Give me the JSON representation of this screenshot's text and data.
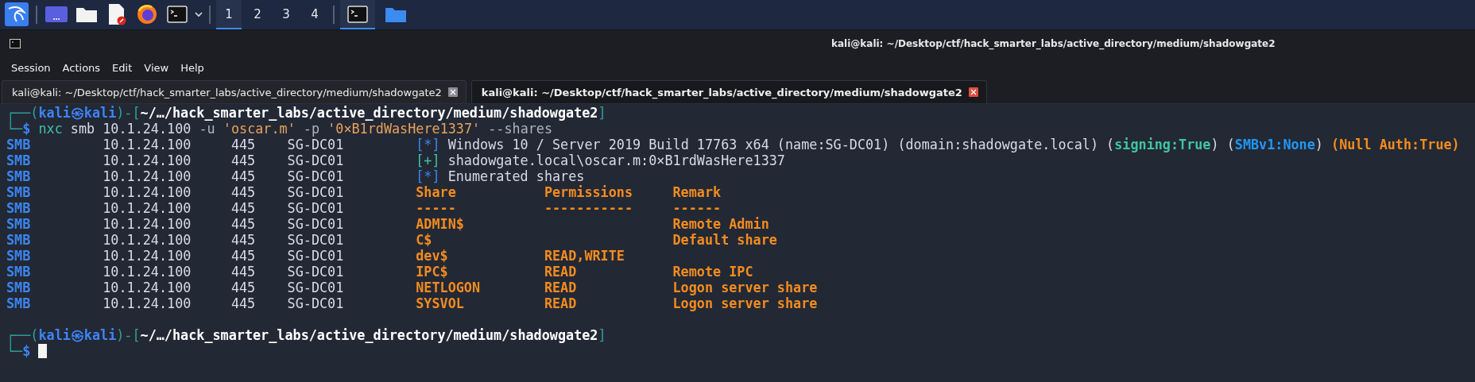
{
  "taskbar": {
    "workspaces": [
      {
        "label": "1",
        "selected": true
      },
      {
        "label": "2",
        "selected": false
      },
      {
        "label": "3",
        "selected": false
      },
      {
        "label": "4",
        "selected": false
      }
    ],
    "windows": [
      {
        "kind": "terminal",
        "active": true
      },
      {
        "kind": "folder",
        "active": false
      }
    ]
  },
  "window": {
    "title": "kali@kali: ~/Desktop/ctf/hack_smarter_labs/active_directory/medium/shadowgate2"
  },
  "menu": [
    "Session",
    "Actions",
    "Edit",
    "View",
    "Help"
  ],
  "tabs": [
    {
      "label": "kali@kali: ~/Desktop/ctf/hack_smarter_labs/active_directory/medium/shadowgate2",
      "selected": false
    },
    {
      "label": "kali@kali: ~/Desktop/ctf/hack_smarter_labs/active_directory/medium/shadowgate2",
      "selected": true
    }
  ],
  "terminal": {
    "blocks": [
      {
        "kind": "prompt",
        "frame_top": [
          {
            "text": "┌──(",
            "kind": "frame"
          },
          {
            "text": "kali㉿kali",
            "kind": "user"
          },
          {
            "text": ")-[",
            "kind": "frame"
          },
          {
            "text": "~/…/hack_smarter_labs/active_directory/medium/shadowgate2",
            "kind": "path"
          },
          {
            "text": "]",
            "kind": "frame"
          }
        ],
        "frame_bottom": "└─",
        "sign": "$",
        "command": [
          {
            "text": "nxc",
            "kind": "program"
          },
          {
            "text": " smb 10.1.24.100 ",
            "kind": "plain"
          },
          {
            "text": "-u",
            "kind": "option"
          },
          {
            "text": " 'oscar.m' ",
            "kind": "string"
          },
          {
            "text": "-p",
            "kind": "option"
          },
          {
            "text": " '0×B1rdWasHere1337' ",
            "kind": "string"
          },
          {
            "text": "--shares",
            "kind": "option"
          }
        ]
      },
      {
        "kind": "message",
        "protocol": "SMB",
        "ip": "10.1.24.100",
        "port": "445",
        "host": "SG-DC01",
        "marker": {
          "text": "[*]",
          "kind": "info"
        },
        "segments": [
          {
            "text": "Windows 10 / Server 2019 Build 17763 x64 (name:SG-DC01) (domain:shadowgate.local) (",
            "kind": "plain"
          },
          {
            "text": "signing:True",
            "kind": "good"
          },
          {
            "text": ") (",
            "kind": "plain"
          },
          {
            "text": "SMBv1:None",
            "kind": "note"
          },
          {
            "text": ") ",
            "kind": "plain"
          },
          {
            "text": "(Null Auth:True)",
            "kind": "warn"
          }
        ]
      },
      {
        "kind": "message",
        "protocol": "SMB",
        "ip": "10.1.24.100",
        "port": "445",
        "host": "SG-DC01",
        "marker": {
          "text": "[+]",
          "kind": "success"
        },
        "segments": [
          {
            "text": "shadowgate.local\\oscar.m:0×B1rdWasHere1337",
            "kind": "plain"
          }
        ]
      },
      {
        "kind": "message",
        "protocol": "SMB",
        "ip": "10.1.24.100",
        "port": "445",
        "host": "SG-DC01",
        "marker": {
          "text": "[*]",
          "kind": "info"
        },
        "segments": [
          {
            "text": "Enumerated shares",
            "kind": "plain"
          }
        ]
      },
      {
        "kind": "share",
        "protocol": "SMB",
        "ip": "10.1.24.100",
        "port": "445",
        "host": "SG-DC01",
        "share": "Share",
        "permissions": "Permissions",
        "remark": "Remark"
      },
      {
        "kind": "share",
        "protocol": "SMB",
        "ip": "10.1.24.100",
        "port": "445",
        "host": "SG-DC01",
        "share": "-----",
        "permissions": "-----------",
        "remark": "------"
      },
      {
        "kind": "share",
        "protocol": "SMB",
        "ip": "10.1.24.100",
        "port": "445",
        "host": "SG-DC01",
        "share": "ADMIN$",
        "remark": "Remote Admin"
      },
      {
        "kind": "share",
        "protocol": "SMB",
        "ip": "10.1.24.100",
        "port": "445",
        "host": "SG-DC01",
        "share": "C$",
        "remark": "Default share"
      },
      {
        "kind": "share",
        "protocol": "SMB",
        "ip": "10.1.24.100",
        "port": "445",
        "host": "SG-DC01",
        "share": "dev$",
        "permissions": "READ,WRITE"
      },
      {
        "kind": "share",
        "protocol": "SMB",
        "ip": "10.1.24.100",
        "port": "445",
        "host": "SG-DC01",
        "share": "IPC$",
        "permissions": "READ",
        "remark": "Remote IPC"
      },
      {
        "kind": "share",
        "protocol": "SMB",
        "ip": "10.1.24.100",
        "port": "445",
        "host": "SG-DC01",
        "share": "NETLOGON",
        "permissions": "READ",
        "remark": "Logon server share"
      },
      {
        "kind": "share",
        "protocol": "SMB",
        "ip": "10.1.24.100",
        "port": "445",
        "host": "SG-DC01",
        "share": "SYSVOL",
        "permissions": "READ",
        "remark": "Logon server share"
      },
      {
        "kind": "blank"
      },
      {
        "kind": "prompt",
        "frame_top": [
          {
            "text": "┌──(",
            "kind": "frame"
          },
          {
            "text": "kali㉿kali",
            "kind": "user"
          },
          {
            "text": ")-[",
            "kind": "frame"
          },
          {
            "text": "~/…/hack_smarter_labs/active_directory/medium/shadowgate2",
            "kind": "path"
          },
          {
            "text": "]",
            "kind": "frame"
          }
        ],
        "frame_bottom": "└─",
        "sign": "$",
        "cursor": true
      }
    ]
  }
}
